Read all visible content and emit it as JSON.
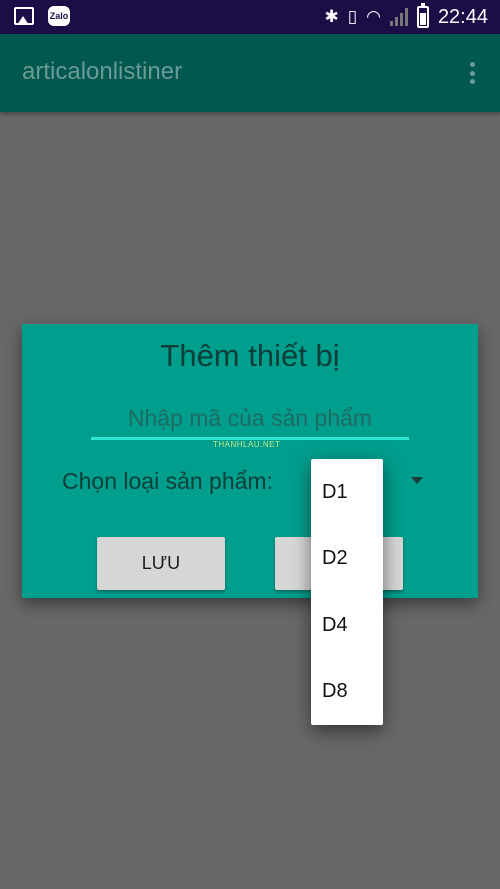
{
  "status_bar": {
    "notifications": [
      "gallery-icon",
      "zalo-icon"
    ],
    "zalo_label": "Zalo",
    "icons": [
      "bluetooth-icon",
      "vibrate-icon",
      "wifi-icon",
      "signal-icon",
      "battery-icon"
    ],
    "bluetooth_glyph": "✱",
    "vibrate_glyph": "▯",
    "wifi_glyph": "◠",
    "time": "22:44"
  },
  "app_bar": {
    "title": "articalonlistiner",
    "menu_icon": "overflow-menu-icon"
  },
  "dialog": {
    "title": "Thêm thiết bị",
    "code_input": {
      "value": "",
      "placeholder": "Nhập mã của sản phẩm"
    },
    "watermark": "THANHLAU.NET",
    "type_label": "Chọn loại sản phẩm:",
    "save_label": "LƯU",
    "cancel_label": ""
  },
  "dropdown": {
    "options": [
      "D1",
      "D2",
      "D4",
      "D8"
    ]
  },
  "colors": {
    "status_bar": "#1c0d47",
    "app_bar_dimmed": "#00584f",
    "dialog": "#009e8d",
    "input_underline": "#2ee6d4",
    "scrim": "#686868",
    "button": "#d6d6d6"
  }
}
